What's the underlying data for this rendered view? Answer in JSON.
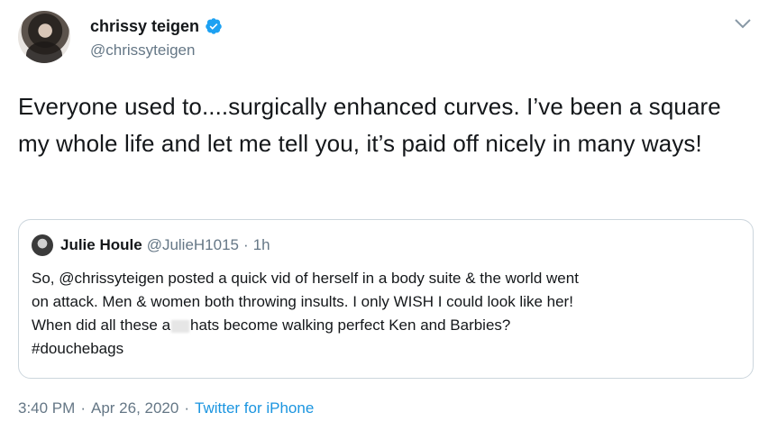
{
  "author": {
    "display_name": "chrissy teigen",
    "handle": "@chrissyteigen",
    "verified_icon": "verified-badge-icon",
    "verified_color": "#1da1f2"
  },
  "tweet": {
    "text": "Everyone used to....surgically enhanced curves. I’ve been a square my whole life and let me tell you, it’s paid off nicely in many ways!"
  },
  "quote": {
    "name": "Julie Houle",
    "handle": "@JulieH1015",
    "separator": "·",
    "time": "1h",
    "lines": [
      "So, @chrissyteigen posted a quick vid of herself in a body suite & the world went",
      "on attack. Men & women both throwing insults. I only WISH I could look like her!",
      "When did all these a",
      "hats become walking perfect Ken and Barbies?",
      "#douchebags"
    ]
  },
  "meta": {
    "time": "3:40 PM",
    "date": "Apr 26, 2020",
    "separator": "·",
    "source": "Twitter for iPhone",
    "source_color": "#1b95e0"
  }
}
